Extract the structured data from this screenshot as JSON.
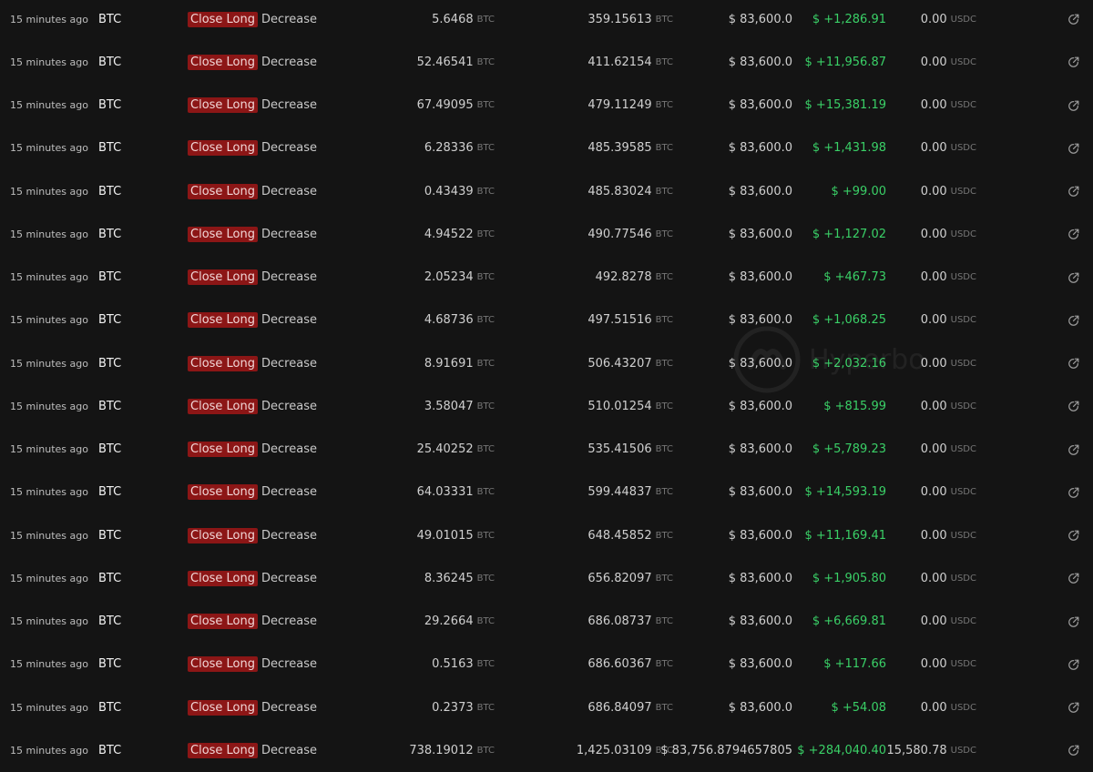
{
  "units": {
    "size": "BTC",
    "position": "BTC",
    "fee": "USDC"
  },
  "watermark": "Hyperbo",
  "trades": [
    {
      "time": "15 minutes ago",
      "coin": "BTC",
      "action": "Close Long",
      "direction": "Decrease",
      "size": "5.6468",
      "position": "359.15613",
      "price": "$ 83,600.0",
      "pnl": "$ +1,286.91",
      "fee": "0.00"
    },
    {
      "time": "15 minutes ago",
      "coin": "BTC",
      "action": "Close Long",
      "direction": "Decrease",
      "size": "52.46541",
      "position": "411.62154",
      "price": "$ 83,600.0",
      "pnl": "$ +11,956.87",
      "fee": "0.00"
    },
    {
      "time": "15 minutes ago",
      "coin": "BTC",
      "action": "Close Long",
      "direction": "Decrease",
      "size": "67.49095",
      "position": "479.11249",
      "price": "$ 83,600.0",
      "pnl": "$ +15,381.19",
      "fee": "0.00"
    },
    {
      "time": "15 minutes ago",
      "coin": "BTC",
      "action": "Close Long",
      "direction": "Decrease",
      "size": "6.28336",
      "position": "485.39585",
      "price": "$ 83,600.0",
      "pnl": "$ +1,431.98",
      "fee": "0.00"
    },
    {
      "time": "15 minutes ago",
      "coin": "BTC",
      "action": "Close Long",
      "direction": "Decrease",
      "size": "0.43439",
      "position": "485.83024",
      "price": "$ 83,600.0",
      "pnl": "$ +99.00",
      "fee": "0.00"
    },
    {
      "time": "15 minutes ago",
      "coin": "BTC",
      "action": "Close Long",
      "direction": "Decrease",
      "size": "4.94522",
      "position": "490.77546",
      "price": "$ 83,600.0",
      "pnl": "$ +1,127.02",
      "fee": "0.00"
    },
    {
      "time": "15 minutes ago",
      "coin": "BTC",
      "action": "Close Long",
      "direction": "Decrease",
      "size": "2.05234",
      "position": "492.8278",
      "price": "$ 83,600.0",
      "pnl": "$ +467.73",
      "fee": "0.00"
    },
    {
      "time": "15 minutes ago",
      "coin": "BTC",
      "action": "Close Long",
      "direction": "Decrease",
      "size": "4.68736",
      "position": "497.51516",
      "price": "$ 83,600.0",
      "pnl": "$ +1,068.25",
      "fee": "0.00"
    },
    {
      "time": "15 minutes ago",
      "coin": "BTC",
      "action": "Close Long",
      "direction": "Decrease",
      "size": "8.91691",
      "position": "506.43207",
      "price": "$ 83,600.0",
      "pnl": "$ +2,032.16",
      "fee": "0.00"
    },
    {
      "time": "15 minutes ago",
      "coin": "BTC",
      "action": "Close Long",
      "direction": "Decrease",
      "size": "3.58047",
      "position": "510.01254",
      "price": "$ 83,600.0",
      "pnl": "$ +815.99",
      "fee": "0.00"
    },
    {
      "time": "15 minutes ago",
      "coin": "BTC",
      "action": "Close Long",
      "direction": "Decrease",
      "size": "25.40252",
      "position": "535.41506",
      "price": "$ 83,600.0",
      "pnl": "$ +5,789.23",
      "fee": "0.00"
    },
    {
      "time": "15 minutes ago",
      "coin": "BTC",
      "action": "Close Long",
      "direction": "Decrease",
      "size": "64.03331",
      "position": "599.44837",
      "price": "$ 83,600.0",
      "pnl": "$ +14,593.19",
      "fee": "0.00"
    },
    {
      "time": "15 minutes ago",
      "coin": "BTC",
      "action": "Close Long",
      "direction": "Decrease",
      "size": "49.01015",
      "position": "648.45852",
      "price": "$ 83,600.0",
      "pnl": "$ +11,169.41",
      "fee": "0.00"
    },
    {
      "time": "15 minutes ago",
      "coin": "BTC",
      "action": "Close Long",
      "direction": "Decrease",
      "size": "8.36245",
      "position": "656.82097",
      "price": "$ 83,600.0",
      "pnl": "$ +1,905.80",
      "fee": "0.00"
    },
    {
      "time": "15 minutes ago",
      "coin": "BTC",
      "action": "Close Long",
      "direction": "Decrease",
      "size": "29.2664",
      "position": "686.08737",
      "price": "$ 83,600.0",
      "pnl": "$ +6,669.81",
      "fee": "0.00"
    },
    {
      "time": "15 minutes ago",
      "coin": "BTC",
      "action": "Close Long",
      "direction": "Decrease",
      "size": "0.5163",
      "position": "686.60367",
      "price": "$ 83,600.0",
      "pnl": "$ +117.66",
      "fee": "0.00"
    },
    {
      "time": "15 minutes ago",
      "coin": "BTC",
      "action": "Close Long",
      "direction": "Decrease",
      "size": "0.2373",
      "position": "686.84097",
      "price": "$ 83,600.0",
      "pnl": "$ +54.08",
      "fee": "0.00"
    },
    {
      "time": "15 minutes ago",
      "coin": "BTC",
      "action": "Close Long",
      "direction": "Decrease",
      "size": "738.19012",
      "position": "1,425.03109",
      "price": "$ 83,756.8794657805",
      "pnl": "$ +284,040.40",
      "fee": "15,580.78"
    }
  ]
}
